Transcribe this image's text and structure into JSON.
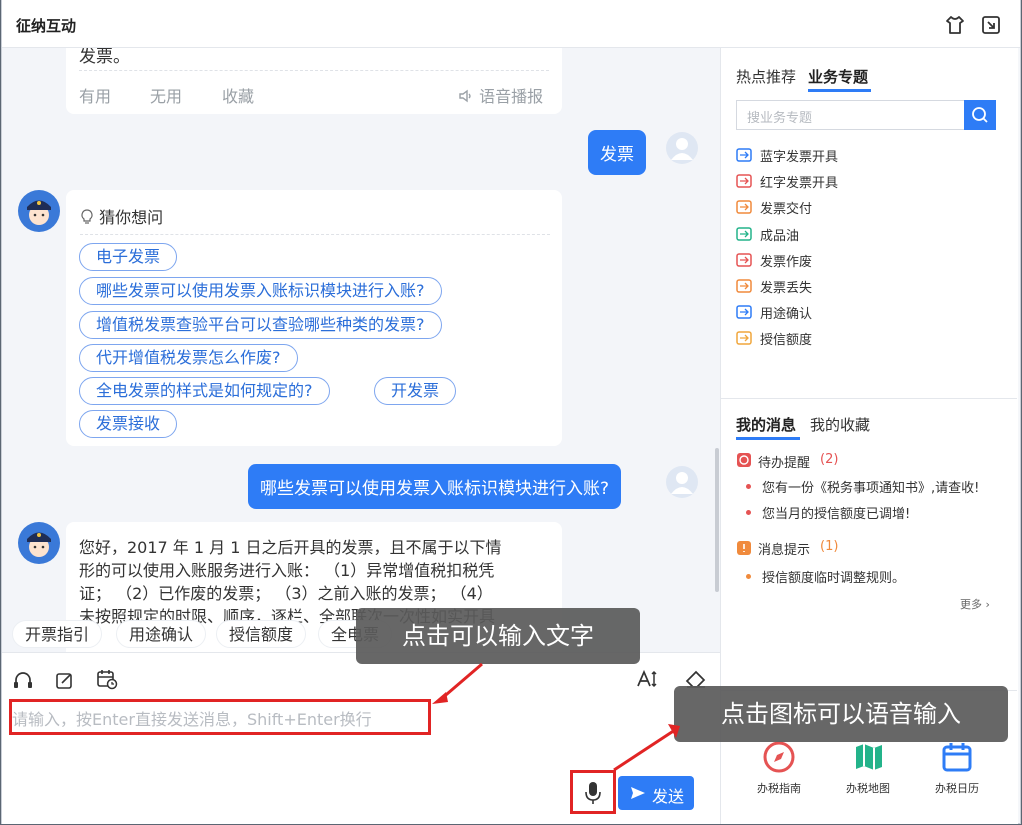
{
  "window": {
    "title": "征纳互动"
  },
  "chat": {
    "prev_answer_tail": "发票。",
    "actions": {
      "useful": "有用",
      "useless": "无用",
      "favorite": "收藏",
      "voice": "语音播报"
    },
    "user_message_1": "发票",
    "guess": {
      "title": "猜你想问",
      "chips": [
        "电子发票",
        "哪些发票可以使用发票入账标识模块进行入账?",
        "增值税发票查验平台可以查验哪些种类的发票?",
        "代开增值税发票怎么作废?",
        "全电发票的样式是如何规定的?",
        "开发票",
        "发票接收"
      ]
    },
    "user_message_2": "哪些发票可以使用发票入账标识模块进行入账?",
    "answer_lines": [
      "您好，2017 年 1 月 1 日之后开具的发票，且不属于以下情",
      "形的可以使用入账服务进行入账：  （1）异常增值税扣税凭",
      "证；  （2）已作废的发票；  （3）之前入账的发票；  （4）",
      "未按照规定的时限、顺序，逐栏、全部联次一次性如实开具"
    ],
    "quick_replies": [
      "开票指引",
      "用途确认",
      "授信额度",
      "全电票"
    ]
  },
  "input": {
    "placeholder": "请输入，按Enter直接发送消息，Shift+Enter换行",
    "send_label": "发送"
  },
  "callouts": {
    "text_input": "点击可以输入文字",
    "voice_input": "点击图标可以语音输入"
  },
  "right_panel": {
    "tabs": [
      "热点推荐",
      "业务专题"
    ],
    "active_tab": "业务专题",
    "search_placeholder": "搜业务专题",
    "topics": [
      {
        "label": "蓝字发票开具",
        "color": "#2e7cf6"
      },
      {
        "label": "红字发票开具",
        "color": "#e55353"
      },
      {
        "label": "发票交付",
        "color": "#f08a3c"
      },
      {
        "label": "成品油",
        "color": "#23b38a"
      },
      {
        "label": "发票作废",
        "color": "#e55353"
      },
      {
        "label": "发票丢失",
        "color": "#f08a3c"
      },
      {
        "label": "用途确认",
        "color": "#2e7cf6"
      },
      {
        "label": "授信额度",
        "color": "#f0a63c"
      }
    ],
    "msg_tabs": [
      "我的消息",
      "我的收藏"
    ],
    "todo": {
      "title": "待办提醒",
      "count": "(2)",
      "items": [
        "您有一份《税务事项通知书》,请查收!",
        "您当月的授信额度已调增!"
      ]
    },
    "notice": {
      "title": "消息提示",
      "count": "(1)",
      "items": [
        "授信额度临时调整规则。"
      ]
    },
    "more": "更多",
    "bottom_nav": [
      "办税指南",
      "办税地图",
      "办税日历"
    ]
  }
}
